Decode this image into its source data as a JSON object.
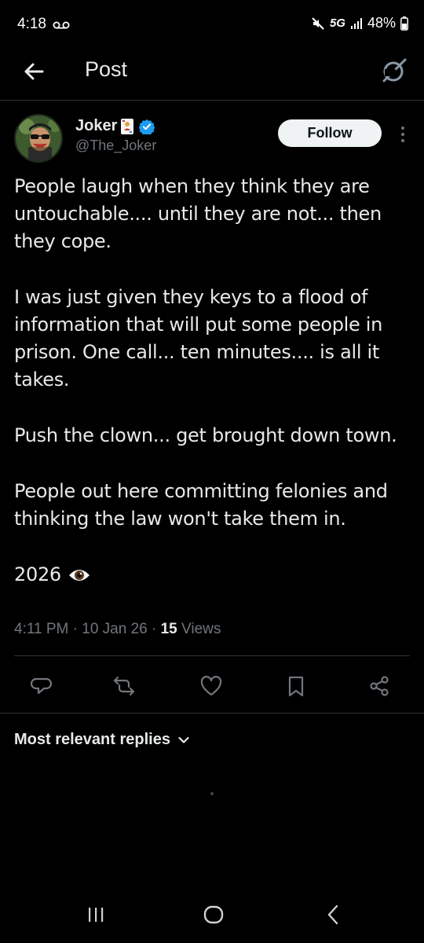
{
  "status_bar": {
    "time": "4:18",
    "network": "5G",
    "battery": "48%"
  },
  "topbar": {
    "title": "Post"
  },
  "author": {
    "display_name": "Joker",
    "handle": "@The_Joker",
    "verified": true,
    "follow_label": "Follow"
  },
  "post": {
    "paragraphs": [
      "People laugh when they think they are untouchable.... until they are not... then they cope.",
      "I was just given they keys to a flood of information that will put some people in prison. One call... ten minutes.... is all it takes.",
      "Push the clown... get brought down town.",
      "People out here committing felonies and thinking the law won't take them in."
    ],
    "last_line": "2026"
  },
  "meta": {
    "time": "4:11 PM",
    "date": "10 Jan 26",
    "views_count": "15",
    "views_label": "Views",
    "separator": "·"
  },
  "actions": [
    "reply-icon",
    "repost-icon",
    "like-icon",
    "bookmark-icon",
    "share-icon"
  ],
  "replies": {
    "sort_label": "Most relevant replies"
  },
  "colors": {
    "background": "#000000",
    "text": "#e7e9ea",
    "secondary": "#71767b",
    "verified": "#1d9bf0",
    "divider": "#2f3336"
  }
}
